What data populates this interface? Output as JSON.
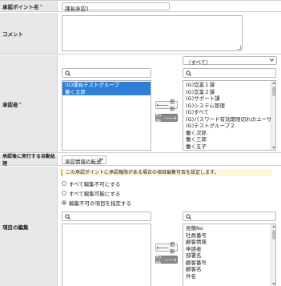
{
  "fields": {
    "approval_point_name": {
      "label": "承認ポイント名",
      "required": true,
      "value": "課長承認1"
    },
    "comment": {
      "label": "コメント",
      "value": ""
    },
    "approvers": {
      "label": "承認者",
      "required": true,
      "filter_value": "（すべて）",
      "selected_items": [
        "(G)課長テストグループ",
        "働く太郎"
      ],
      "available_items": [
        "(G)営業１課",
        "(G)営業２課",
        "(G)サポート課",
        "(G)システム管理",
        "(G)すべて",
        "(G)パスワード有効期限切れのユーザ",
        "(G)テストグループ２",
        "働く次郎",
        "働く三郎",
        "働く五子"
      ],
      "add_label": "追加",
      "remove_label": "削除"
    },
    "auto_process": {
      "label": "承認後に実行する自動処理",
      "value": "承認情報の転送"
    },
    "item_editing": {
      "label": "項目の編集",
      "notice": "この承認ポイントに承認権限がある場合の項目編集可否を設定します。",
      "options": [
        {
          "label": "すべて編集不可にする",
          "checked": false
        },
        {
          "label": "すべて編集可能にする",
          "checked": false
        },
        {
          "label": "編集不可の項目を指定する",
          "checked": true
        }
      ],
      "available_items": [
        "見積No",
        "社員番号",
        "顧客情報",
        "申請者",
        "部署名",
        "顧客番号",
        "顧客名",
        "件名"
      ],
      "add_label": "追加",
      "remove_label": "削除"
    }
  },
  "colors": {
    "required_mark": "#d9534f",
    "selection": "#2f7fd8",
    "notice_bg": "#fff7d9"
  }
}
